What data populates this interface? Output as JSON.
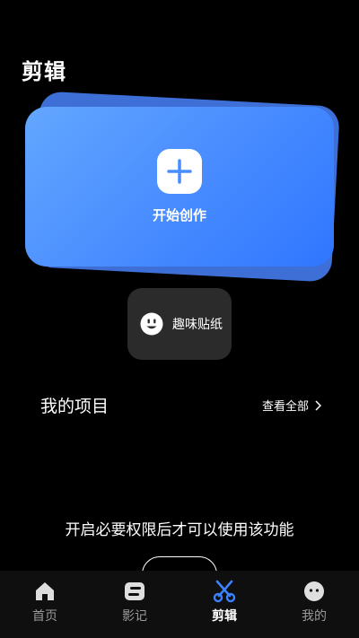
{
  "page": {
    "title": "剪辑"
  },
  "create_card": {
    "label": "开始创作",
    "icon": "plus-icon",
    "accent": "#4a8dff"
  },
  "sticker": {
    "label": "趣味贴纸",
    "icon": "smiley-icon"
  },
  "projects": {
    "title": "我的项目",
    "view_all": "查看全部",
    "view_all_icon": "chevron-right-icon"
  },
  "permission": {
    "message": "开启必要权限后才可以使用该功能"
  },
  "nav": {
    "items": [
      {
        "label": "首页",
        "icon": "home-icon",
        "active": false
      },
      {
        "label": "影记",
        "icon": "film-icon",
        "active": false
      },
      {
        "label": "剪辑",
        "icon": "scissors-icon",
        "active": true
      },
      {
        "label": "我的",
        "icon": "profile-icon",
        "active": false
      }
    ],
    "active_color": "#3b82ff"
  }
}
